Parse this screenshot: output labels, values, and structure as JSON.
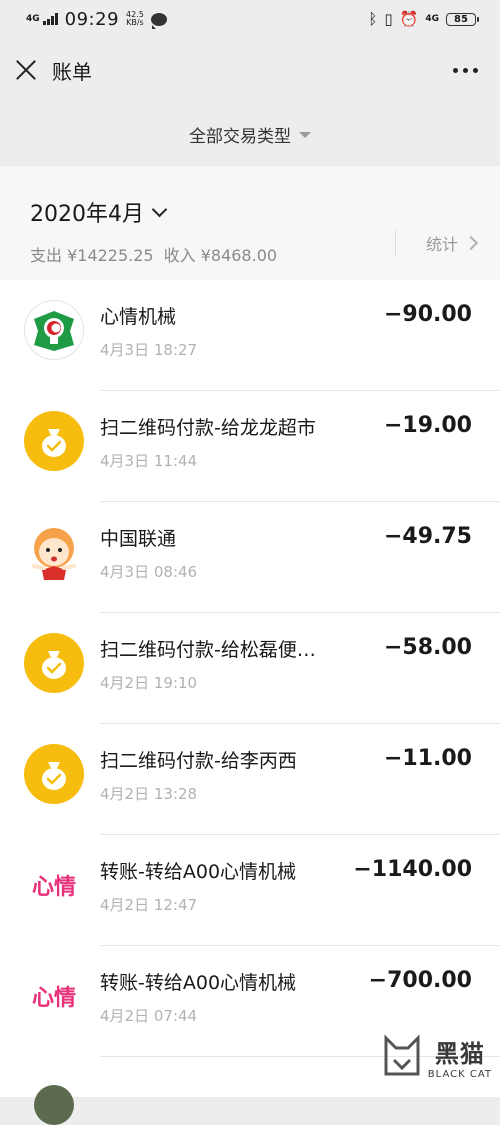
{
  "status_bar": {
    "network": "4G",
    "time": "09:29",
    "speed": "42.5",
    "speed_unit": "KB/s",
    "network2": "4G",
    "battery": "85"
  },
  "nav": {
    "title": "账单"
  },
  "filter": {
    "label": "全部交易类型"
  },
  "month": {
    "label": "2020年4月",
    "expense": "支出 ¥14225.25",
    "income": "收入 ¥8468.00",
    "stats_label": "统计"
  },
  "transactions": [
    {
      "icon": "bank-logo-icon",
      "name": "心情机械",
      "date": "4月3日 18:27",
      "amount": "−90.00"
    },
    {
      "icon": "moneybag-icon",
      "name": "扫二维码付款-给龙龙超市",
      "date": "4月3日 11:44",
      "amount": "−19.00"
    },
    {
      "icon": "cartoon-girl-avatar",
      "name": "中国联通",
      "date": "4月3日 08:46",
      "amount": "−49.75"
    },
    {
      "icon": "moneybag-icon",
      "name": "扫二维码付款-给松磊便…",
      "date": "4月2日 19:10",
      "amount": "−58.00"
    },
    {
      "icon": "moneybag-icon",
      "name": "扫二维码付款-给李丙西",
      "date": "4月2日 13:28",
      "amount": "−11.00"
    },
    {
      "icon": "xinqing-text-logo",
      "avatar_text": "心情",
      "name": "转账-转给A00心情机械",
      "date": "4月2日 12:47",
      "amount": "−1140.00"
    },
    {
      "icon": "xinqing-text-logo",
      "avatar_text": "心情",
      "name": "转账-转给A00心情机械",
      "date": "4月2日 07:44",
      "amount": "−700.00"
    }
  ],
  "watermark": {
    "cn": "黑猫",
    "en": "BLACK CAT"
  },
  "colors": {
    "pay_yellow": "#f6bd0e",
    "brand_pink": "#e8317a",
    "bank_green": "#1f9a45",
    "bank_red": "#d6222a"
  }
}
